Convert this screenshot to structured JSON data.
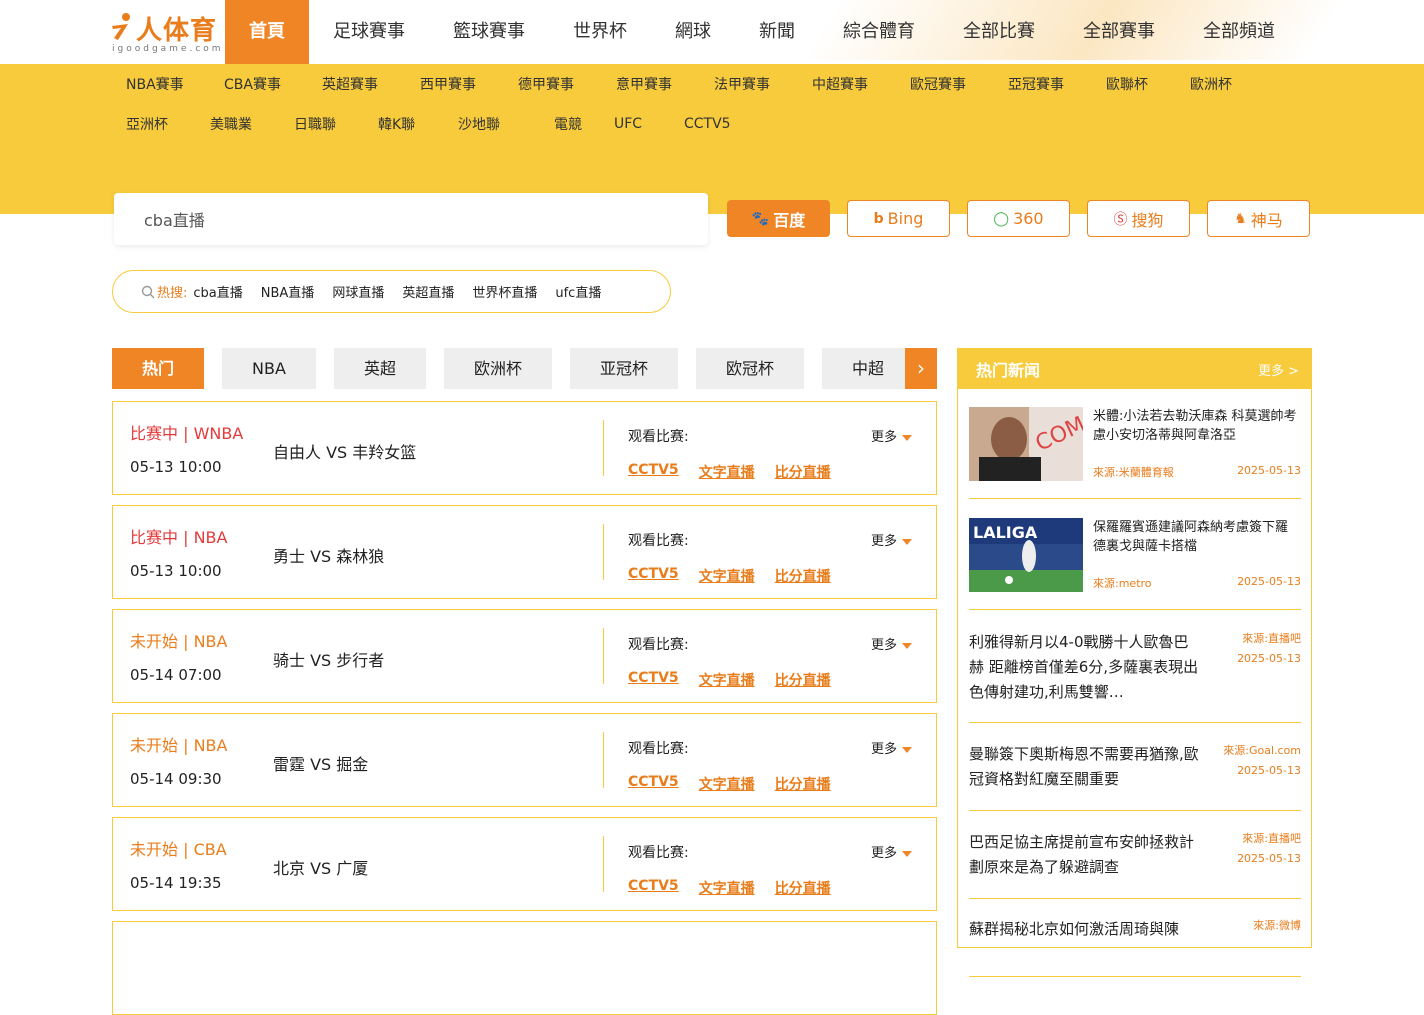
{
  "brand": {
    "name": "人体育",
    "sub": "igoodgame.com"
  },
  "nav": [
    "首頁",
    "足球賽事",
    "籃球賽事",
    "世界杯",
    "網球",
    "新聞",
    "綜合體育",
    "全部比賽",
    "全部賽事",
    "全部頻道"
  ],
  "subnav_row1": [
    "NBA賽事",
    "CBA賽事",
    "英超賽事",
    "西甲賽事",
    "德甲賽事",
    "意甲賽事",
    "法甲賽事",
    "中超賽事",
    "歐冠賽事",
    "亞冠賽事",
    "歐聯杯",
    "歐洲杯"
  ],
  "subnav_row2": [
    "亞洲杯",
    "美職業",
    "日職聯",
    "韓K聯",
    "沙地聯",
    "電競",
    "UFC",
    "CCTV5"
  ],
  "search": {
    "value": "cba直播"
  },
  "engines": [
    "百度",
    "Bing",
    "360",
    "搜狗",
    "神马"
  ],
  "hot": {
    "label": "热搜:",
    "keywords": [
      "cba直播",
      "NBA直播",
      "网球直播",
      "英超直播",
      "世界杯直播",
      "ufc直播"
    ]
  },
  "tabs": [
    "热门",
    "NBA",
    "英超",
    "欧洲杯",
    "亚冠杯",
    "欧冠杯",
    "中超"
  ],
  "tab_arrow": "›",
  "watch_label": "观看比赛:",
  "more_label": "更多",
  "matches": [
    {
      "status": "比赛中 | WNBA",
      "state": "live",
      "time": "05-13 10:00",
      "teams": "自由人 VS 丰羚女篮",
      "links": [
        "CCTV5",
        "文字直播",
        "比分直播"
      ]
    },
    {
      "status": "比赛中 | NBA",
      "state": "live",
      "time": "05-13 10:00",
      "teams": "勇士 VS 森林狼",
      "links": [
        "CCTV5",
        "文字直播",
        "比分直播"
      ]
    },
    {
      "status": "未开始 | NBA",
      "state": "pend",
      "time": "05-14 07:00",
      "teams": "骑士 VS 步行者",
      "links": [
        "CCTV5",
        "文字直播",
        "比分直播"
      ]
    },
    {
      "status": "未开始 | NBA",
      "state": "pend",
      "time": "05-14 09:30",
      "teams": "雷霆 VS 掘金",
      "links": [
        "CCTV5",
        "文字直播",
        "比分直播"
      ]
    },
    {
      "status": "未开始 | CBA",
      "state": "pend",
      "time": "05-14 19:35",
      "teams": "北京 VS 广厦",
      "links": [
        "CCTV5",
        "文字直播",
        "比分直播"
      ]
    }
  ],
  "news": {
    "title": "热门新闻",
    "more": "更多 >",
    "items": [
      {
        "title": "米體:小法若去勒沃庫森 科莫選帥考慮小安切洛蒂與阿韋洛亞",
        "source": "來源:米蘭體育報",
        "date": "2025-05-13",
        "img": true
      },
      {
        "title": "保羅羅賓遜建議阿森納考慮簽下羅德裏戈與薩卡搭檔",
        "source": "來源:metro",
        "date": "2025-05-13",
        "img": true
      },
      {
        "title": "利雅得新月以4-0戰勝十人歐魯巴赫 距離榜首僅差6分,多薩裏表現出色傳射建功,利馬雙響…",
        "source": "來源:直播吧",
        "date": "2025-05-13",
        "img": false
      },
      {
        "title": "曼聯簽下奧斯梅恩不需要再猶豫,歐冠資格對紅魔至關重要",
        "source": "來源:Goal.com",
        "date": "2025-05-13",
        "img": false
      },
      {
        "title": "巴西足協主席提前宣布安帥拯救計劃原來是為了躲避調查",
        "source": "來源:直播吧",
        "date": "2025-05-13",
        "img": false
      },
      {
        "title": "蘇群揭秘北京如何激活周琦與陳",
        "source": "來源:微博",
        "date": "",
        "img": false
      }
    ]
  },
  "colors": {
    "accent": "#f08525",
    "band": "#f7cb3c",
    "live": "#e33b3b"
  }
}
